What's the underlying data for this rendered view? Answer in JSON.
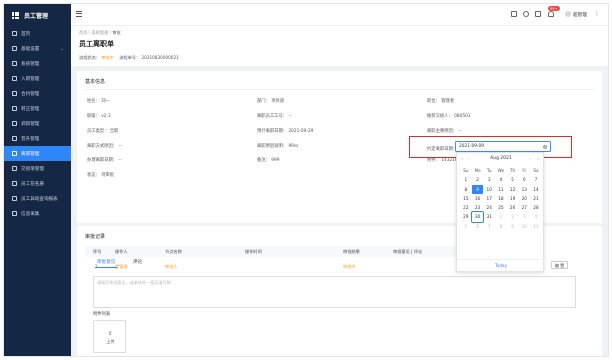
{
  "app": {
    "title": "员工管理"
  },
  "sidebar": {
    "items": [
      {
        "label": "首页",
        "active": false,
        "expandable": false
      },
      {
        "label": "基础设置",
        "active": false,
        "expandable": true
      },
      {
        "label": "系统管理",
        "active": false,
        "expandable": false
      },
      {
        "label": "入职管理",
        "active": false,
        "expandable": false
      },
      {
        "label": "合约管理",
        "active": false,
        "expandable": false
      },
      {
        "label": "转正管理",
        "active": false,
        "expandable": false
      },
      {
        "label": "调岗管理",
        "active": false,
        "expandable": false
      },
      {
        "label": "晋升管理",
        "active": false,
        "expandable": false
      },
      {
        "label": "离职管理",
        "active": true,
        "expandable": false
      },
      {
        "label": "交接单管理",
        "active": false,
        "expandable": false
      },
      {
        "label": "员工花名册",
        "active": false,
        "expandable": false
      },
      {
        "label": "员工异动查询报表",
        "active": false,
        "expandable": false
      },
      {
        "label": "信息采集",
        "active": false,
        "expandable": false
      }
    ]
  },
  "topbar": {
    "badge": "99+",
    "user_name": "超管理"
  },
  "breadcrumb": {
    "home": "首页",
    "sep": "/",
    "parent": "离职管理",
    "current": "审批"
  },
  "page": {
    "title": "员工离职单",
    "flow_status_label": "流程状态：",
    "flow_status_value": "审批中",
    "flow_no_label": "流程单号：",
    "flow_no_value": "20210830000021"
  },
  "basic_info": {
    "title": "基本信息",
    "fields": {
      "name": "姓名： 刘一",
      "dept": "部门： 项目部",
      "position": "职位： 管理者",
      "rank": "职级： v2.3",
      "resign_staff_no": "离职员工工号： --",
      "handover_person": "推荐交接人： 080501",
      "emp_type": "员工类型： 全职",
      "expected_date": "预计离职日期： 2021-09-29",
      "main_reason": "离职主要原因： --",
      "resign_type": "离职方式原因： --",
      "resign_reason": "离职原因说明： 99ss",
      "agreed_date_label": "约定离职日期：",
      "agreed_date_value": "2021-09-09",
      "handover_date": "办理离职日期： --",
      "remark": "备注： 999",
      "attachment": "附件： 1432160",
      "status": "状态： 待审批"
    }
  },
  "calendar": {
    "month_label": "Aug  2021",
    "prev_year": "«",
    "prev_month": "‹",
    "next_month": "›",
    "next_year": "»",
    "weekdays": [
      "Su",
      "Mo",
      "Tu",
      "We",
      "Th",
      "Fr",
      "Sa"
    ],
    "today_label": "Today",
    "selected_day": 9,
    "today_day": 30,
    "days": [
      [
        "1",
        "2",
        "3",
        "4",
        "5",
        "6",
        "7"
      ],
      [
        "8",
        "9",
        "10",
        "11",
        "12",
        "13",
        "14"
      ],
      [
        "15",
        "16",
        "17",
        "18",
        "19",
        "20",
        "21"
      ],
      [
        "22",
        "23",
        "24",
        "25",
        "26",
        "27",
        "28"
      ],
      [
        "29",
        "30",
        "31",
        "1",
        "2",
        "3",
        "4"
      ],
      [
        "5",
        "6",
        "7",
        "8",
        "9",
        "10",
        "11"
      ]
    ]
  },
  "approval": {
    "title": "审批记录",
    "columns": [
      "序号",
      "操作人",
      "节点名称",
      "操作时间",
      "审批结果",
      "审批意见 | 评论"
    ],
    "rows": [
      {
        "no": "1",
        "operator": "超管理",
        "node": "审批人",
        "time": "",
        "result": "审批中",
        "comment": ""
      }
    ],
    "row_button": "编 置"
  },
  "tabs": {
    "opinion": "审批意见",
    "comment": "评论"
  },
  "comment_box": {
    "placeholder": "请填写审批意见，或者休补一意见请写稿"
  },
  "attachments": {
    "label": "附件列表",
    "upload": "上传",
    "upload_icon": "↥"
  }
}
